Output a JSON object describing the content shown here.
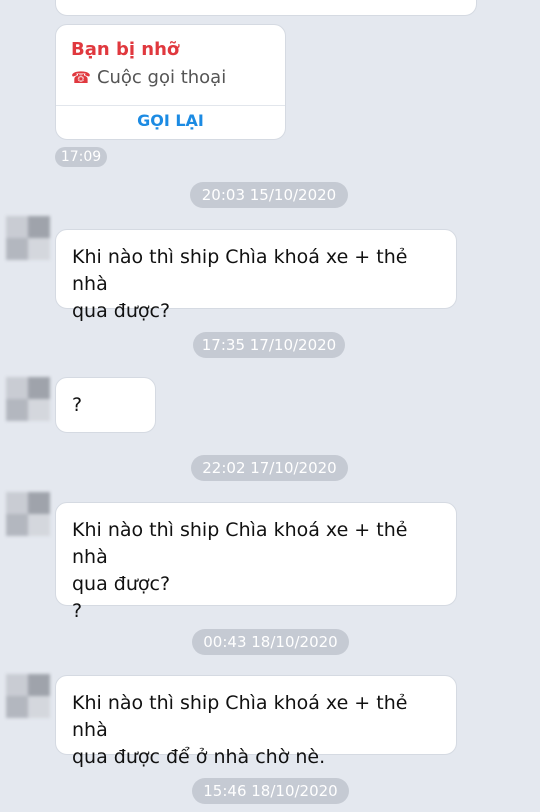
{
  "missed_call": {
    "title": "Bạn bị nhỡ",
    "icon": "missed-call-icon",
    "subtitle": "Cuộc gọi thoại",
    "call_back_label": "GỌI LẠI",
    "time": "17:09"
  },
  "messages": [
    {
      "timestamp": "20:03 15/10/2020",
      "text": "Khi nào thì ship Chìa khoá xe + thẻ nhà\nqua được?"
    },
    {
      "timestamp": "17:35 17/10/2020",
      "text": "?"
    },
    {
      "timestamp": "22:02 17/10/2020",
      "text": "Khi nào thì ship Chìa khoá xe + thẻ nhà\nqua được?\n?"
    },
    {
      "timestamp": "00:43 18/10/2020",
      "text": "Khi nào thì ship Chìa khoá xe + thẻ nhà\nqua được để ở nhà chờ nè."
    }
  ],
  "last_timestamp": "15:46 18/10/2020",
  "colors": {
    "background": "#e4e8ef",
    "missed": "#e0383e",
    "link": "#1c8be3",
    "pill": "#c5cad3"
  }
}
